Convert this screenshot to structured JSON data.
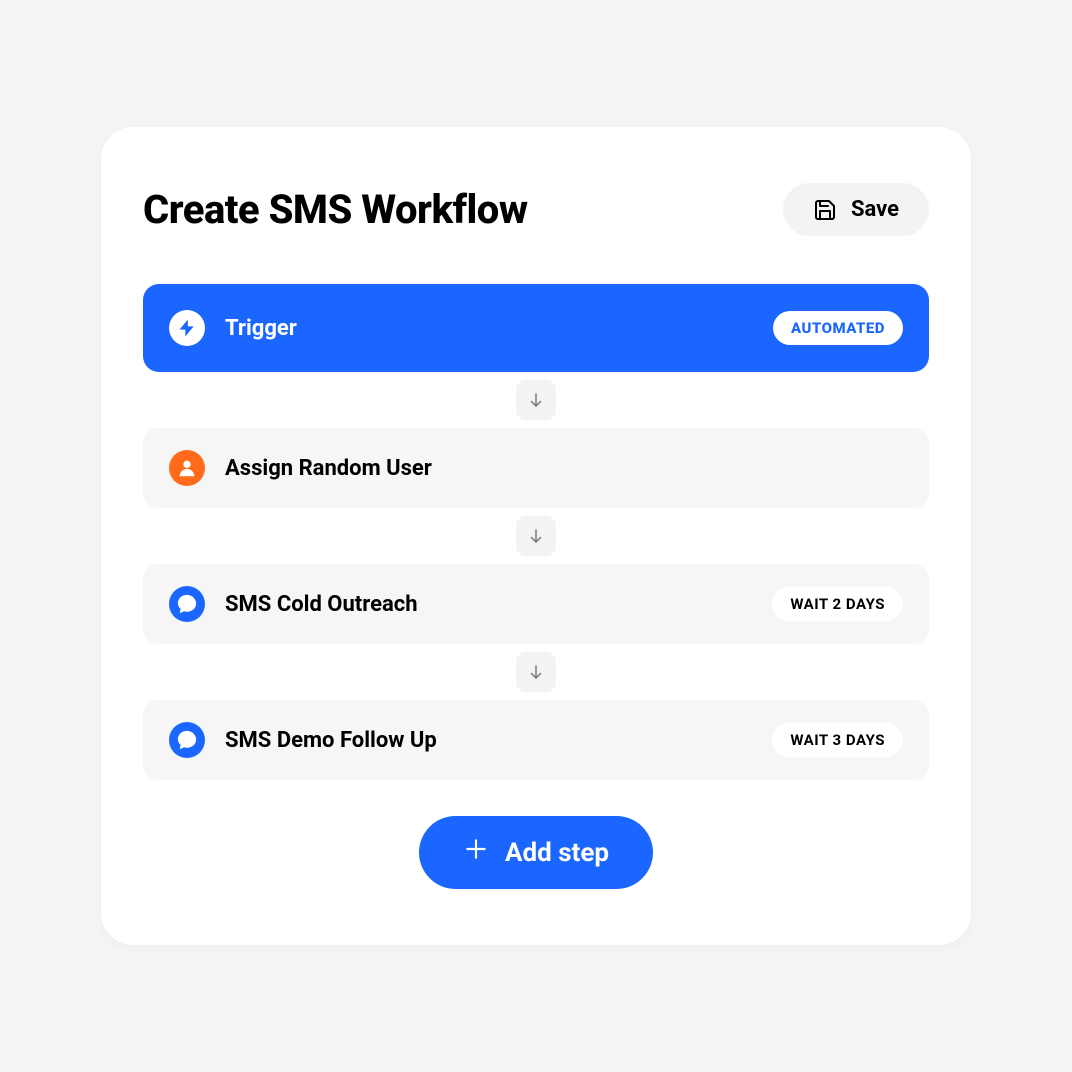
{
  "header": {
    "title": "Create SMS Workflow",
    "save_label": "Save"
  },
  "steps": {
    "trigger": {
      "label": "Trigger",
      "badge": "AUTOMATED"
    },
    "assign": {
      "label": "Assign Random User"
    },
    "sms1": {
      "label": "SMS Cold Outreach",
      "badge": "WAIT 2 DAYS"
    },
    "sms2": {
      "label": "SMS Demo Follow Up",
      "badge": "WAIT 3 DAYS"
    }
  },
  "footer": {
    "add_step_label": "Add step"
  }
}
